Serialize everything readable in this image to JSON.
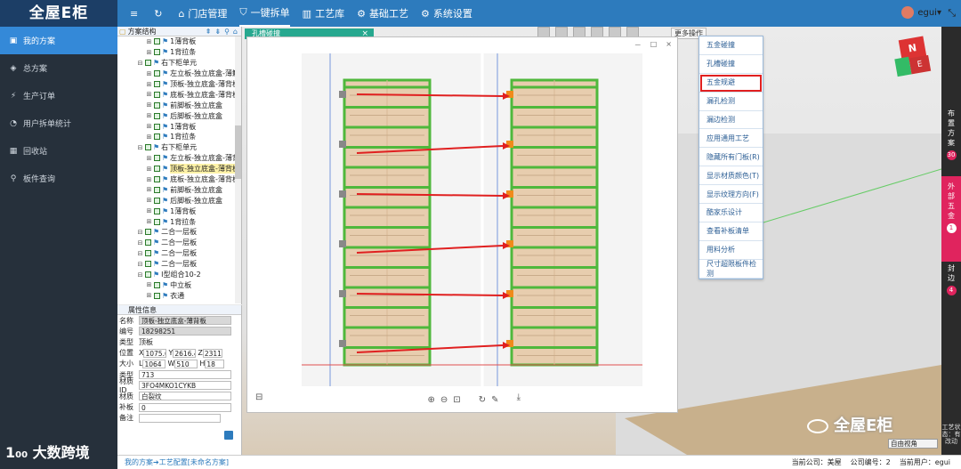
{
  "app": {
    "logo": "全屋E柜",
    "nav": [
      {
        "icon": "≡",
        "label": "",
        "name": "menu-toggle"
      },
      {
        "icon": "↻",
        "label": "",
        "name": "refresh"
      },
      {
        "icon": "⌂",
        "label": "门店管理",
        "name": "store-mgmt"
      },
      {
        "icon": "⛉",
        "label": "一键拆单",
        "name": "one-click-split"
      },
      {
        "icon": "▥",
        "label": "工艺库",
        "name": "process-lib"
      },
      {
        "icon": "⚙",
        "label": "基础工艺",
        "name": "basic-process"
      },
      {
        "icon": "⚙",
        "label": "系统设置",
        "name": "system-settings"
      }
    ],
    "user": "egui",
    "fullscreen_icon": "⤡"
  },
  "sidebar": {
    "items": [
      {
        "icon": "▣",
        "label": "我的方案"
      },
      {
        "icon": "◈",
        "label": "总方案"
      },
      {
        "icon": "⚡",
        "label": "生产订单"
      },
      {
        "icon": "◔",
        "label": "用户拆单统计"
      },
      {
        "icon": "▦",
        "label": "回收站"
      },
      {
        "icon": "⚲",
        "label": "板件查询"
      }
    ],
    "watermark": "大数跨境"
  },
  "tree": {
    "header": "方案结构",
    "rows": [
      {
        "indent": 2,
        "label": "1薄背板",
        "sel": false
      },
      {
        "indent": 2,
        "label": "1背拉条",
        "sel": false
      },
      {
        "indent": 1,
        "label": "右下柜单元",
        "sel": false
      },
      {
        "indent": 2,
        "label": "左立板-独立底盒-薄籍",
        "sel": false
      },
      {
        "indent": 2,
        "label": "顶板-独立底盒-薄背板",
        "sel": false
      },
      {
        "indent": 2,
        "label": "底板-独立底盒-薄背板",
        "sel": false
      },
      {
        "indent": 2,
        "label": "前脚板-独立底盒",
        "sel": false
      },
      {
        "indent": 2,
        "label": "后脚板-独立底盒",
        "sel": false
      },
      {
        "indent": 2,
        "label": "1薄背板",
        "sel": false
      },
      {
        "indent": 2,
        "label": "1背拉条",
        "sel": false
      },
      {
        "indent": 1,
        "label": "右下柜单元",
        "sel": false
      },
      {
        "indent": 2,
        "label": "左立板-独立底盒-薄背",
        "sel": false
      },
      {
        "indent": 2,
        "label": "顶板-独立底盒-薄背板",
        "sel": true
      },
      {
        "indent": 2,
        "label": "底板-独立底盒-薄背板",
        "sel": false
      },
      {
        "indent": 2,
        "label": "前脚板-独立底盒",
        "sel": false
      },
      {
        "indent": 2,
        "label": "后脚板-独立底盒",
        "sel": false
      },
      {
        "indent": 2,
        "label": "1薄背板",
        "sel": false
      },
      {
        "indent": 2,
        "label": "1背拉条",
        "sel": false
      },
      {
        "indent": 1,
        "label": "二合一层板",
        "sel": false
      },
      {
        "indent": 1,
        "label": "二合一层板",
        "sel": false
      },
      {
        "indent": 1,
        "label": "二合一层板",
        "sel": false
      },
      {
        "indent": 1,
        "label": "二合一层板",
        "sel": false
      },
      {
        "indent": 1,
        "label": "I型组合10-2",
        "sel": false
      },
      {
        "indent": 2,
        "label": "中立板",
        "sel": false
      },
      {
        "indent": 2,
        "label": "衣通",
        "sel": false
      }
    ]
  },
  "props": {
    "header": "属性信息",
    "name_label": "名称",
    "name_value": "顶板-独立底盒-薄背板",
    "code_label": "编号",
    "code_value": "18298251",
    "type_label": "类型",
    "type_value": "顶板",
    "pos_label": "位置",
    "pos_x": "1075.6",
    "pos_y": "2616.4",
    "pos_z": "2311",
    "size_label": "大小",
    "size_l": "1064",
    "size_w": "510",
    "size_h": "18",
    "kind_label": "类型",
    "kind_value": "713",
    "material_id_label": "材质ID",
    "material_id_value": "3FO4MKO1CYKB",
    "material_label": "材质",
    "material_value": "白裂纹",
    "patch_label": "补板",
    "patch_value": "0",
    "note_label": "备注",
    "note_value": ""
  },
  "status": {
    "breadcrumb": "我的方案➔工艺配置[未命名方案]",
    "company": "当前公司：美屋",
    "company_code": "公司编号：2",
    "current_user": "当前用户：egui"
  },
  "dialog": {
    "back_title": "孔槽碰撞",
    "close": "×",
    "viewer_ctrls": [
      "－",
      "□",
      "×"
    ],
    "bar_left": "⊟",
    "bar_icons": [
      "⊕",
      "⊖",
      "⊡",
      "↻",
      "✎"
    ],
    "bar_right": "⤓"
  },
  "menu": {
    "more_ops": "更多操作",
    "items": [
      {
        "label": "五金碰撞",
        "highlight": false
      },
      {
        "label": "孔槽碰撞",
        "highlight": false
      },
      {
        "label": "五金规避",
        "highlight": true
      },
      {
        "label": "漏孔检测",
        "highlight": false
      },
      {
        "label": "漏边检测",
        "highlight": false
      },
      {
        "label": "应用通用工艺",
        "highlight": false
      },
      {
        "label": "隐藏所有门板(R)",
        "highlight": false
      },
      {
        "label": "显示材质颜色(T)",
        "highlight": false
      },
      {
        "label": "显示纹理方向(F)",
        "highlight": false
      },
      {
        "label": "酷家乐设计",
        "highlight": false
      },
      {
        "label": "查看补板清单",
        "highlight": false
      },
      {
        "label": "用料分析",
        "highlight": false
      },
      {
        "label": "尺寸超限板件检测",
        "highlight": false
      }
    ]
  },
  "right_tabs": [
    {
      "label": "布置方案",
      "badge": "30",
      "pink": false
    },
    {
      "label": "外部五金",
      "badge": "1",
      "pink": true
    },
    {
      "label": "封边",
      "badge": "4",
      "pink": false
    }
  ],
  "right_note": "工艺状态：有改动",
  "view_select": "自由视角",
  "watermark_right": "全屋E柜",
  "cube_labels": {
    "top": "N",
    "front": "E"
  },
  "colors": {
    "accent": "#2d7bbd",
    "highlight_red": "#e02020",
    "frame_green": "#4fb83c",
    "panel_wood": "#e7cdae"
  }
}
